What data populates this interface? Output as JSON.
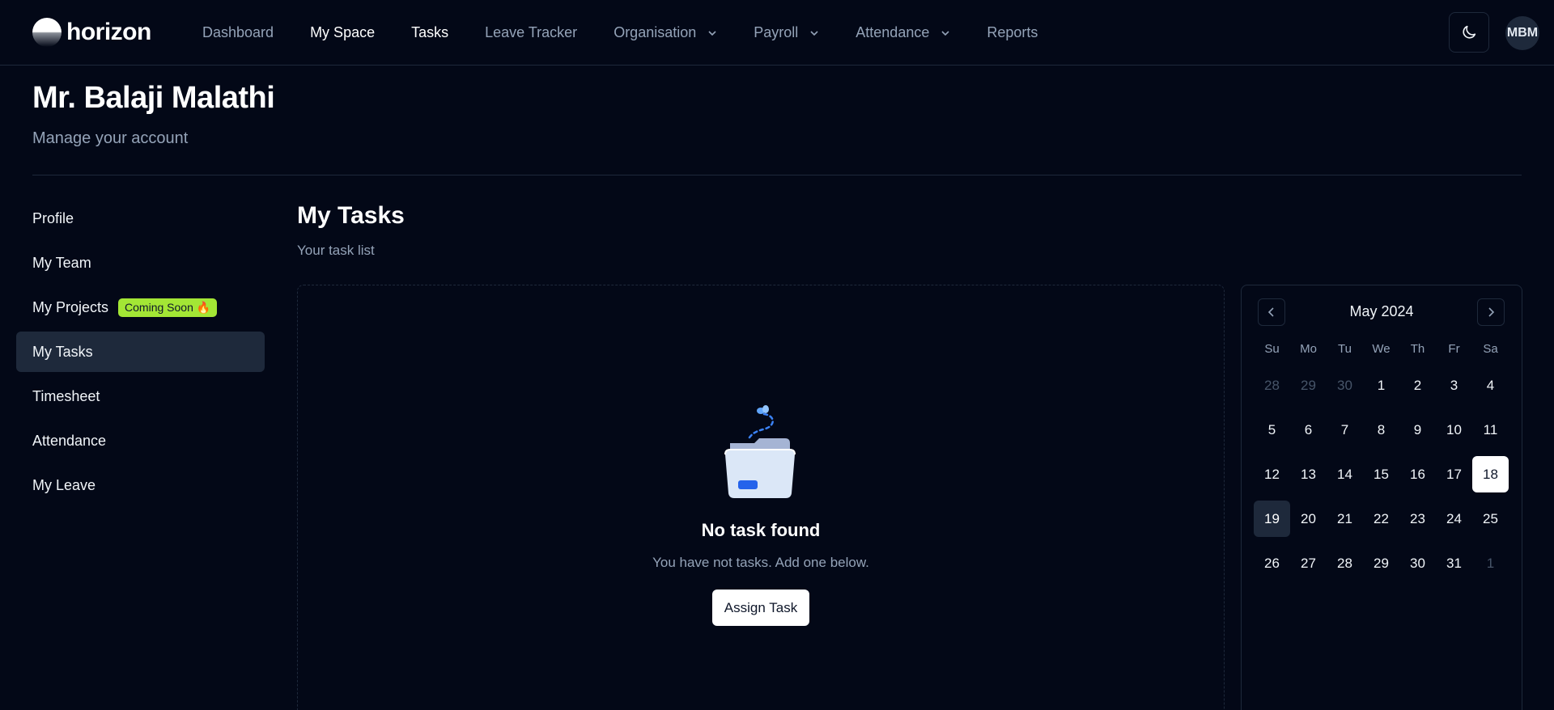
{
  "brand": {
    "name": "horizon"
  },
  "nav": {
    "items": [
      {
        "label": "Dashboard",
        "active": false,
        "dropdown": false
      },
      {
        "label": "My Space",
        "active": true,
        "dropdown": false
      },
      {
        "label": "Tasks",
        "active": true,
        "dropdown": false
      },
      {
        "label": "Leave Tracker",
        "active": false,
        "dropdown": false
      },
      {
        "label": "Organisation",
        "active": false,
        "dropdown": true
      },
      {
        "label": "Payroll",
        "active": false,
        "dropdown": true
      },
      {
        "label": "Attendance",
        "active": false,
        "dropdown": true
      },
      {
        "label": "Reports",
        "active": false,
        "dropdown": false
      }
    ]
  },
  "user": {
    "initials": "MBM"
  },
  "header": {
    "title": "Mr. Balaji Malathi",
    "subtitle": "Manage your account"
  },
  "sidebar": {
    "items": [
      {
        "label": "Profile"
      },
      {
        "label": "My Team"
      },
      {
        "label": "My Projects",
        "badge": "Coming Soon 🔥"
      },
      {
        "label": "My Tasks",
        "active": true
      },
      {
        "label": "Timesheet"
      },
      {
        "label": "Attendance"
      },
      {
        "label": "My Leave"
      }
    ]
  },
  "main": {
    "title": "My Tasks",
    "subtitle": "Your task list",
    "empty": {
      "title": "No task found",
      "description": "You have not tasks. Add one below.",
      "button": "Assign Task"
    }
  },
  "calendar": {
    "month": "May 2024",
    "weekdays": [
      "Su",
      "Mo",
      "Tu",
      "We",
      "Th",
      "Fr",
      "Sa"
    ],
    "weeks": [
      [
        "28",
        "29",
        "30",
        "1",
        "2",
        "3",
        "4"
      ],
      [
        "5",
        "6",
        "7",
        "8",
        "9",
        "10",
        "11"
      ],
      [
        "12",
        "13",
        "14",
        "15",
        "16",
        "17",
        "18"
      ],
      [
        "19",
        "20",
        "21",
        "22",
        "23",
        "24",
        "25"
      ],
      [
        "26",
        "27",
        "28",
        "29",
        "30",
        "31",
        "1"
      ]
    ],
    "outside": [
      "0-0",
      "0-1",
      "0-2",
      "4-6"
    ],
    "selected": "2-6",
    "today": "3-0"
  },
  "colors": {
    "background": "#030817",
    "border": "#1e293b",
    "muted_text": "#94a3b8",
    "badge": "#a3e635",
    "illustration_blue": "#2563eb"
  },
  "icons": {
    "theme": "moon-icon",
    "dropdown": "chevron-down-icon",
    "prev": "chevron-left-icon",
    "next": "chevron-right-icon",
    "empty": "empty-folder-icon"
  }
}
